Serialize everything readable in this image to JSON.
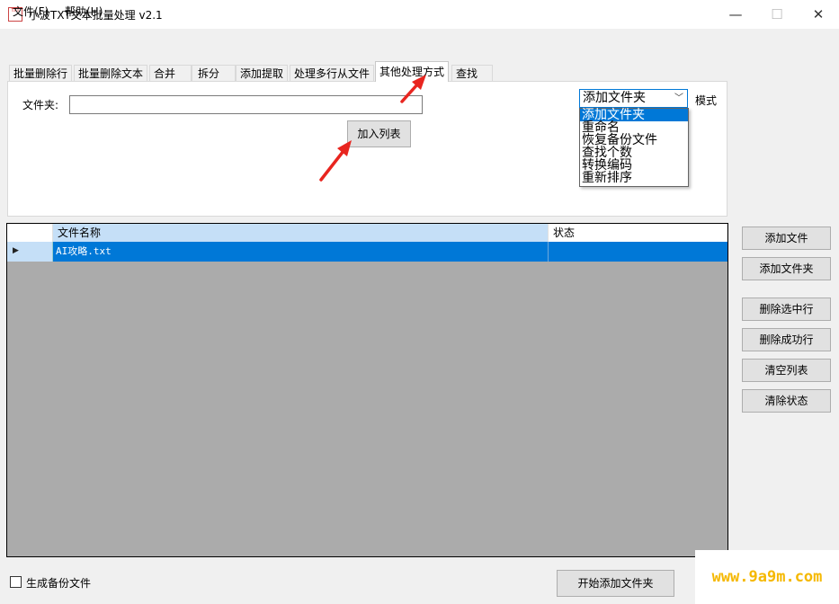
{
  "window": {
    "title": "小波TXT文本批量处理 v2.1",
    "icon_text": "TXT",
    "min_glyph": "—",
    "max_glyph": "☐",
    "close_glyph": "✕"
  },
  "menu": [
    "文件(F)",
    "帮助(H)"
  ],
  "tabs": [
    "批量删除行",
    "批量删除文本",
    "合并",
    "拆分",
    "添加提取",
    "处理多行从文件",
    "其他处理方式",
    "查找"
  ],
  "active_tab": "其他处理方式",
  "panel": {
    "folder_label": "文件夹:",
    "folder_value": "",
    "add_list_button": "加入列表",
    "mode_selected": "添加文件夹",
    "mode_label": "模式",
    "mode_options": [
      "添加文件夹",
      "重命名",
      "恢复备份文件",
      "查找个数",
      "转换编码",
      "重新排序"
    ]
  },
  "grid": {
    "columns": [
      "文件名称",
      "状态"
    ],
    "rows": [
      {
        "name": "AI攻略.txt",
        "status": ""
      }
    ]
  },
  "side_buttons": [
    "添加文件",
    "添加文件夹",
    "删除选中行",
    "删除成功行",
    "清空列表",
    "清除状态"
  ],
  "footer": {
    "backup_label": "生成备份文件",
    "backup_checked": false,
    "start_button": "开始添加文件夹"
  },
  "watermark": "www.9a9m.com",
  "colors": {
    "selection": "#0078d7",
    "header_highlight": "#c5dff7",
    "arrow": "#e8251f",
    "watermark": "#f5b800"
  }
}
